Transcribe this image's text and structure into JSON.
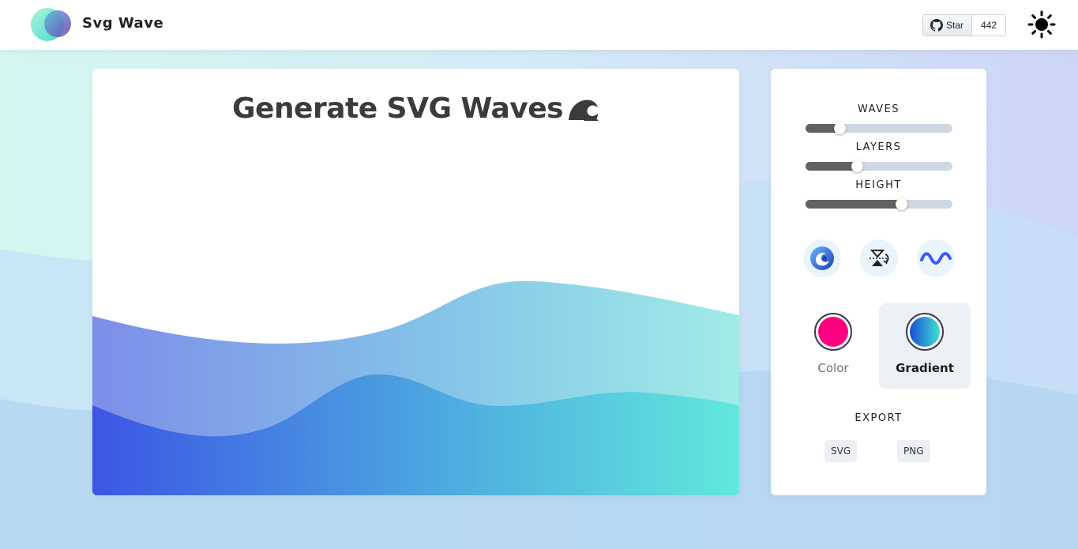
{
  "header": {
    "brand": "Svg Wave",
    "github": {
      "star_label": "Star",
      "star_count": "442"
    }
  },
  "preview": {
    "title": "Generate SVG Waves"
  },
  "controls": {
    "waves": {
      "label": "WAVES",
      "value_fraction": 0.23
    },
    "layers": {
      "label": "LAYERS",
      "value_fraction": 0.35
    },
    "height": {
      "label": "HEIGHT",
      "value_fraction": 0.65
    },
    "actions": [
      "randomize-icon",
      "invert-icon",
      "wave-shape-icon"
    ],
    "fill_modes": [
      {
        "label": "Color",
        "color": "#ff0080",
        "active": false
      },
      {
        "label": "Gradient",
        "colors": [
          "#1a4fd8",
          "#40e0d0"
        ],
        "active": true
      }
    ],
    "export": {
      "label": "EXPORT",
      "svg_label": "SVG",
      "png_label": "PNG"
    }
  },
  "colors": {
    "gradient_start": "#3c56e4",
    "gradient_end": "#62e8dc",
    "accent_pink": "#ff0080"
  }
}
